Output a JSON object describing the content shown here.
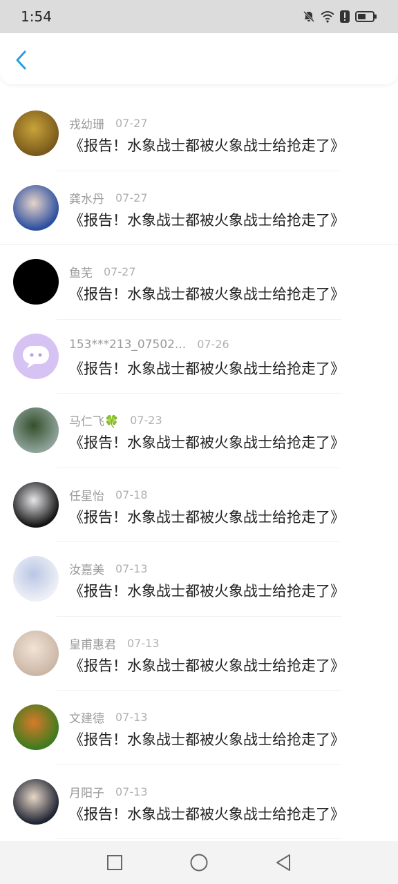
{
  "status_bar": {
    "time": "1:54"
  },
  "header": {
    "back_icon": "chevron-left-icon"
  },
  "comments": [
    {
      "name": "戎幼珊",
      "date": "07-27",
      "text": "《报告！水象战士都被火象战士给抢走了》",
      "avatar_colors": [
        "#7a5a1c",
        "#c9a33a"
      ]
    },
    {
      "name": "龚水丹",
      "date": "07-27",
      "text": "《报告！水象战士都被火象战士给抢走了》",
      "avatar_colors": [
        "#2c4fa0",
        "#e7d4c9"
      ]
    },
    {
      "name": "鱼芜",
      "date": "07-27",
      "text": "《报告！水象战士都被火象战士给抢走了》",
      "avatar_colors": [
        "#000000",
        "#000000"
      ]
    },
    {
      "name": "153***213_07502...",
      "date": "07-26",
      "text": "《报告！水象战士都被火象战士给抢走了》",
      "avatar_colors": [
        "#d7c3f3",
        "#ffffff"
      ]
    },
    {
      "name": "马仁飞🍀",
      "date": "07-23",
      "text": "《报告！水象战士都被火象战士给抢走了》",
      "avatar_colors": [
        "#8fa39a",
        "#34502c"
      ]
    },
    {
      "name": "任星怡",
      "date": "07-18",
      "text": "《报告！水象战士都被火象战士给抢走了》",
      "avatar_colors": [
        "#141414",
        "#e6e6ea"
      ]
    },
    {
      "name": "汝嘉美",
      "date": "07-13",
      "text": "《报告！水象战士都被火象战士给抢走了》",
      "avatar_colors": [
        "#eef0f6",
        "#b9c6e4"
      ]
    },
    {
      "name": "皇甫惠君",
      "date": "07-13",
      "text": "《报告！水象战士都被火象战士给抢走了》",
      "avatar_colors": [
        "#cbb7a6",
        "#f1e3d6"
      ]
    },
    {
      "name": "文建德",
      "date": "07-13",
      "text": "《报告！水象战士都被火象战士给抢走了》",
      "avatar_colors": [
        "#3e7b1f",
        "#d77a2a"
      ]
    },
    {
      "name": "月阳子",
      "date": "07-13",
      "text": "《报告！水象战士都被火象战士给抢走了》",
      "avatar_colors": [
        "#1f2433",
        "#e8d7c7"
      ]
    }
  ],
  "nav_bar": {
    "recents_icon": "square-icon",
    "home_icon": "circle-icon",
    "back_icon": "triangle-back-icon"
  }
}
